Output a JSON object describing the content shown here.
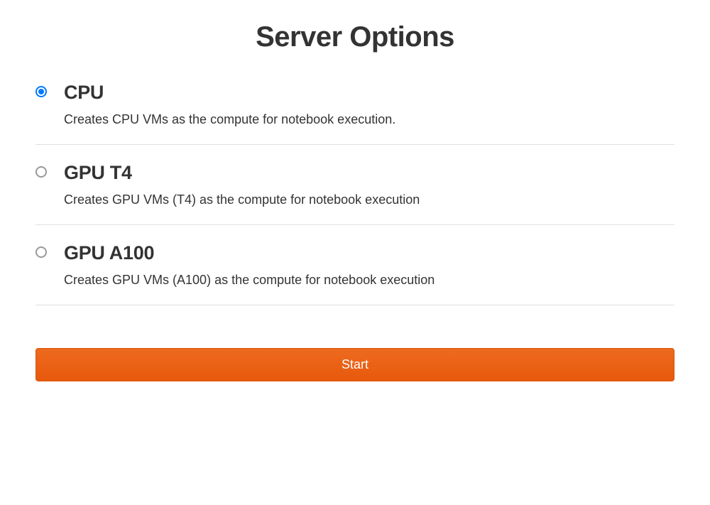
{
  "title": "Server Options",
  "options": [
    {
      "id": "cpu",
      "label": "CPU",
      "description": "Creates CPU VMs as the compute for notebook execution.",
      "selected": true
    },
    {
      "id": "gpu-t4",
      "label": "GPU T4",
      "description": "Creates GPU VMs (T4) as the compute for notebook execution",
      "selected": false
    },
    {
      "id": "gpu-a100",
      "label": "GPU A100",
      "description": "Creates GPU VMs (A100) as the compute for notebook execution",
      "selected": false
    }
  ],
  "start_label": "Start",
  "colors": {
    "accent": "#e8590c",
    "radio_selected": "#007aff"
  }
}
